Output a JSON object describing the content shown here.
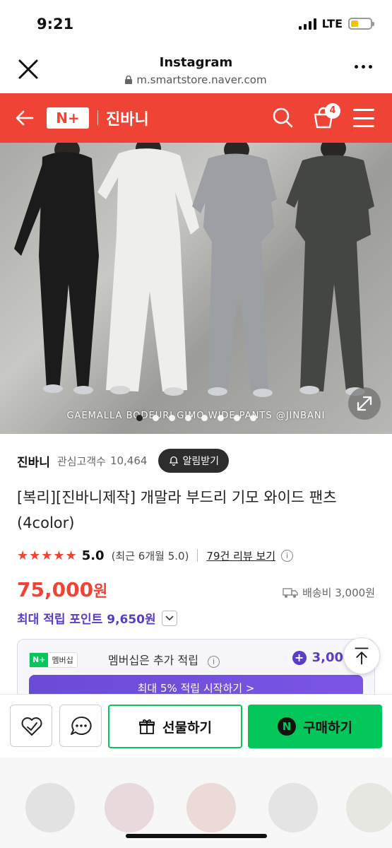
{
  "status_bar": {
    "time": "9:21",
    "network": "LTE",
    "battery_level": 0.4
  },
  "browser": {
    "title": "Instagram",
    "url": "m.smartstore.naver.com"
  },
  "store_header": {
    "logo": "N+",
    "brand": "진바니",
    "cart_count": "4",
    "color": "#ef4335"
  },
  "hero": {
    "caption": "GAEMALLA BODEURI GIMO WIDE PANTS @JINBANI",
    "slides_total": 8,
    "active_slide": 1
  },
  "product": {
    "store_name": "진바니",
    "subscribers_label": "관심고객수",
    "subscribers": "10,464",
    "alarm_button": "알림받기",
    "title": "[복리][진바니제작] 개말라 부드리 기모 와이드 팬츠 (4color)",
    "stars": "★★★★★",
    "rating": "5.0",
    "recent_rating": "(최근 6개월 5.0)",
    "review_link": "79건 리뷰 보기",
    "price": "75,000",
    "price_unit": "원",
    "shipping": "배송비 3,000원",
    "points": "최대 적립 포인트 9,650원"
  },
  "membership": {
    "tag_logo": "N+",
    "tag_label": "멤버십",
    "text": "멤버십은 추가 적립",
    "amount": "3,00",
    "cta": "최대 5% 적립 시작하기 >"
  },
  "actions": {
    "gift": "선물하기",
    "buy": "구매하기",
    "buy_logo": "N"
  },
  "colors": {
    "naver_green": "#03c75a",
    "point_purple": "#5b3cc4",
    "sale_red": "#ef4335"
  }
}
